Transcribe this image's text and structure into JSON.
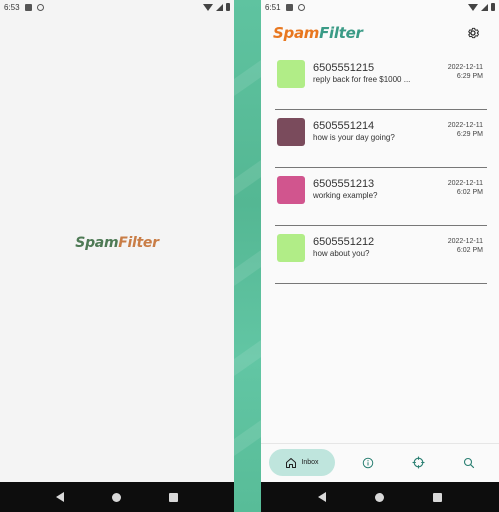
{
  "left_screen": {
    "status_time": "6:53",
    "logo_part1": "Spam",
    "logo_part2": "Filter"
  },
  "right_screen": {
    "status_time": "6:51",
    "header": {
      "logo_part1": "Spam",
      "logo_part2": "Filter",
      "settings_icon": "gear-icon"
    },
    "messages": [
      {
        "number": "6505551215",
        "preview": "reply back for free $1000 ...",
        "date": "2022-12-11",
        "time": "6:29 PM",
        "avatar_color": "#b1ed87"
      },
      {
        "number": "6505551214",
        "preview": "how is your day going?",
        "date": "2022-12-11",
        "time": "6:29 PM",
        "avatar_color": "#7a4b5c"
      },
      {
        "number": "6505551213",
        "preview": "working example?",
        "date": "2022-12-11",
        "time": "6:02 PM",
        "avatar_color": "#d1558e"
      },
      {
        "number": "6505551212",
        "preview": "how about you?",
        "date": "2022-12-11",
        "time": "6:02 PM",
        "avatar_color": "#b1ed87"
      }
    ],
    "tabs": {
      "inbox_label": "Inbox",
      "inbox_icon": "home-icon",
      "info_icon": "info-icon",
      "target_icon": "crosshair-icon",
      "search_icon": "search-icon"
    }
  },
  "colors": {
    "brand_orange": "#e8771f",
    "brand_teal": "#3a9b86",
    "tab_active_bg": "#bfe5dd",
    "stripe": "#5fc3a0"
  }
}
